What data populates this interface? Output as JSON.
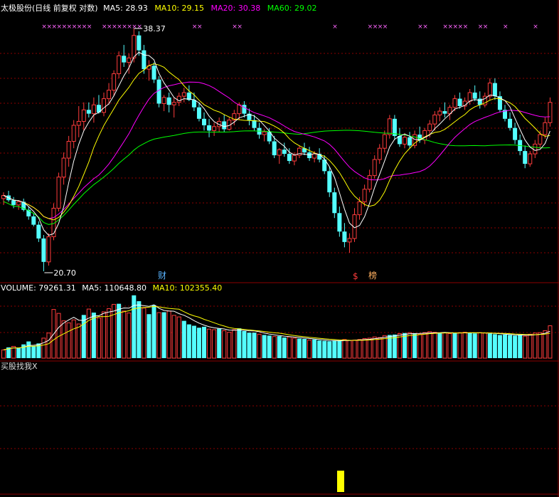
{
  "colors": {
    "background": "#000000",
    "up": "#ff3c3c",
    "down": "#54ffff",
    "grid": "#8c0000",
    "ma5": "#ffffff",
    "ma10": "#ffff00",
    "ma20": "#ff00ff",
    "ma60": "#00ff00",
    "signal": "#ffff00"
  },
  "header": {
    "title": "太极股份(日线 前复权 对数)",
    "ma5_label": "MA5:",
    "ma5_value": "28.93",
    "ma10_label": "MA10:",
    "ma10_value": "29.15",
    "ma20_label": "MA20:",
    "ma20_value": "30.38",
    "ma60_label": "MA60:",
    "ma60_value": "29.02"
  },
  "volume_header": {
    "label": "VOLUME:",
    "value": "79261.31",
    "ma5_label": "MA5:",
    "ma5_value": "110648.80",
    "ma10_label": "MA10:",
    "ma10_value": "102355.40"
  },
  "indicator_header": {
    "label": "买股找我X"
  },
  "chart_data": {
    "type": "candlestick",
    "scale": "log",
    "max_label": "38.37",
    "min_label": "20.70",
    "event_labels": {
      "cai": "财",
      "dollar": "$",
      "bang": "榜"
    },
    "candles": [
      [
        24.9,
        25.3,
        24.5,
        25.1
      ],
      [
        25.1,
        25.4,
        24.7,
        24.8
      ],
      [
        24.8,
        25.0,
        24.3,
        24.5
      ],
      [
        24.5,
        24.8,
        24.2,
        24.7
      ],
      [
        24.7,
        24.9,
        24.1,
        24.2
      ],
      [
        24.2,
        24.4,
        23.6,
        23.8
      ],
      [
        23.8,
        24.0,
        23.2,
        23.3
      ],
      [
        23.3,
        23.5,
        22.3,
        22.5
      ],
      [
        22.5,
        22.7,
        20.7,
        21.2
      ],
      [
        21.2,
        22.8,
        21.0,
        22.6
      ],
      [
        22.6,
        24.6,
        22.4,
        24.3
      ],
      [
        24.3,
        26.6,
        24.1,
        26.3
      ],
      [
        26.3,
        28.0,
        25.8,
        27.6
      ],
      [
        27.6,
        29.2,
        27.0,
        28.8
      ],
      [
        28.8,
        30.4,
        28.3,
        30.0
      ],
      [
        30.0,
        31.5,
        29.1,
        30.3
      ],
      [
        30.3,
        31.8,
        29.6,
        31.2
      ],
      [
        31.2,
        31.8,
        30.6,
        30.9
      ],
      [
        30.9,
        32.2,
        30.2,
        31.6
      ],
      [
        31.6,
        32.4,
        30.9,
        31.0
      ],
      [
        31.0,
        32.6,
        30.7,
        32.1
      ],
      [
        32.1,
        33.4,
        31.6,
        32.8
      ],
      [
        32.8,
        34.5,
        32.3,
        34.2
      ],
      [
        34.2,
        36.2,
        33.8,
        35.8
      ],
      [
        35.8,
        36.8,
        34.8,
        35.2
      ],
      [
        35.2,
        36.0,
        34.2,
        35.6
      ],
      [
        35.6,
        38.37,
        35.2,
        37.7
      ],
      [
        37.7,
        38.1,
        35.8,
        36.3
      ],
      [
        36.3,
        36.8,
        34.2,
        34.6
      ],
      [
        34.6,
        35.4,
        33.6,
        34.9
      ],
      [
        34.9,
        35.2,
        33.4,
        33.7
      ],
      [
        33.7,
        34.0,
        31.4,
        31.7
      ],
      [
        31.7,
        32.4,
        31.1,
        32.2
      ],
      [
        32.2,
        32.6,
        31.0,
        31.6
      ],
      [
        31.6,
        32.2,
        30.6,
        31.8
      ],
      [
        31.8,
        32.6,
        31.5,
        32.3
      ],
      [
        32.3,
        33.0,
        31.8,
        32.6
      ],
      [
        32.6,
        33.2,
        31.9,
        32.0
      ],
      [
        32.0,
        32.6,
        31.1,
        31.4
      ],
      [
        31.4,
        31.8,
        30.3,
        30.5
      ],
      [
        30.5,
        31.0,
        29.6,
        30.0
      ],
      [
        30.0,
        30.5,
        29.1,
        29.6
      ],
      [
        29.6,
        30.2,
        29.2,
        29.9
      ],
      [
        29.9,
        30.6,
        29.5,
        30.3
      ],
      [
        30.3,
        30.8,
        29.5,
        29.7
      ],
      [
        29.7,
        30.6,
        29.6,
        30.4
      ],
      [
        30.4,
        31.2,
        30.0,
        30.9
      ],
      [
        30.9,
        31.8,
        30.4,
        31.6
      ],
      [
        31.6,
        31.9,
        30.6,
        30.9
      ],
      [
        30.9,
        31.3,
        30.0,
        30.4
      ],
      [
        30.4,
        30.8,
        29.6,
        29.8
      ],
      [
        29.8,
        30.2,
        29.0,
        29.3
      ],
      [
        29.3,
        29.7,
        28.8,
        29.5
      ],
      [
        29.5,
        29.8,
        28.6,
        28.8
      ],
      [
        28.8,
        29.2,
        27.6,
        27.8
      ],
      [
        27.8,
        28.3,
        27.2,
        28.2
      ],
      [
        28.2,
        28.7,
        27.7,
        27.9
      ],
      [
        27.9,
        28.3,
        27.2,
        27.4
      ],
      [
        27.4,
        28.0,
        27.1,
        27.8
      ],
      [
        27.8,
        28.5,
        27.6,
        28.3
      ],
      [
        28.3,
        28.7,
        27.8,
        28.0
      ],
      [
        28.0,
        28.4,
        27.4,
        27.6
      ],
      [
        27.6,
        28.1,
        27.3,
        27.9
      ],
      [
        27.9,
        28.3,
        27.3,
        27.5
      ],
      [
        27.5,
        27.8,
        26.5,
        26.7
      ],
      [
        26.7,
        27.0,
        25.0,
        25.3
      ],
      [
        25.3,
        25.6,
        23.7,
        24.0
      ],
      [
        24.0,
        24.4,
        22.6,
        22.9
      ],
      [
        22.9,
        23.4,
        22.0,
        22.3
      ],
      [
        22.3,
        22.8,
        21.7,
        22.5
      ],
      [
        22.5,
        24.3,
        22.3,
        23.9
      ],
      [
        23.9,
        25.0,
        23.6,
        24.7
      ],
      [
        24.7,
        25.8,
        24.4,
        25.5
      ],
      [
        25.5,
        26.8,
        25.3,
        26.4
      ],
      [
        26.4,
        27.8,
        26.2,
        27.5
      ],
      [
        27.5,
        28.6,
        27.2,
        28.3
      ],
      [
        28.3,
        29.6,
        28.0,
        29.3
      ],
      [
        29.3,
        30.8,
        29.0,
        30.5
      ],
      [
        30.5,
        30.8,
        28.9,
        29.2
      ],
      [
        29.2,
        29.8,
        28.4,
        28.6
      ],
      [
        28.6,
        29.4,
        28.3,
        29.1
      ],
      [
        29.1,
        29.5,
        28.3,
        28.5
      ],
      [
        28.5,
        29.6,
        28.3,
        29.3
      ],
      [
        29.3,
        29.9,
        28.7,
        28.9
      ],
      [
        28.9,
        29.8,
        28.6,
        29.6
      ],
      [
        29.6,
        30.4,
        29.1,
        30.1
      ],
      [
        30.1,
        31.1,
        29.6,
        30.8
      ],
      [
        30.8,
        31.4,
        30.3,
        31.1
      ],
      [
        31.1,
        31.8,
        30.6,
        30.9
      ],
      [
        30.9,
        31.6,
        30.4,
        31.4
      ],
      [
        31.4,
        32.4,
        31.1,
        32.1
      ],
      [
        32.1,
        32.6,
        31.3,
        31.5
      ],
      [
        31.5,
        32.2,
        31.2,
        31.9
      ],
      [
        31.9,
        32.9,
        31.6,
        32.6
      ],
      [
        32.6,
        33.2,
        31.9,
        32.1
      ],
      [
        32.1,
        32.7,
        31.3,
        31.6
      ],
      [
        31.6,
        32.6,
        31.4,
        32.3
      ],
      [
        32.3,
        33.8,
        32.0,
        33.4
      ],
      [
        33.4,
        33.8,
        32.0,
        32.3
      ],
      [
        32.3,
        32.7,
        31.0,
        31.2
      ],
      [
        31.2,
        31.6,
        30.3,
        30.5
      ],
      [
        30.5,
        31.0,
        29.6,
        29.8
      ],
      [
        29.8,
        30.2,
        28.6,
        28.9
      ],
      [
        28.9,
        29.3,
        27.8,
        28.1
      ],
      [
        28.1,
        28.5,
        26.9,
        27.2
      ],
      [
        27.2,
        28.1,
        27.0,
        27.9
      ],
      [
        27.9,
        28.9,
        27.6,
        28.6
      ],
      [
        28.6,
        29.6,
        28.3,
        29.3
      ],
      [
        29.3,
        30.6,
        29.0,
        30.2
      ],
      [
        30.2,
        32.2,
        29.9,
        31.8
      ]
    ],
    "volume": {
      "values": [
        42,
        55,
        60,
        52,
        70,
        85,
        62,
        75,
        102,
        128,
        248,
        228,
        190,
        180,
        195,
        174,
        220,
        250,
        232,
        205,
        236,
        252,
        274,
        277,
        240,
        230,
        320,
        290,
        255,
        224,
        270,
        232,
        234,
        240,
        218,
        210,
        190,
        172,
        165,
        155,
        160,
        148,
        145,
        150,
        140,
        132,
        145,
        152,
        138,
        130,
        130,
        122,
        118,
        115,
        110,
        112,
        105,
        108,
        102,
        100,
        98,
        92,
        95,
        90,
        88,
        86,
        88,
        90,
        95,
        90,
        92,
        95,
        100,
        102,
        108,
        105,
        115,
        118,
        120,
        125,
        128,
        130,
        125,
        122,
        130,
        135,
        132,
        128,
        130,
        125,
        128,
        130,
        132,
        128,
        126,
        130,
        128,
        125,
        122,
        118,
        120,
        118,
        115,
        118,
        112,
        122,
        128,
        130,
        140,
        165
      ],
      "up_flags": [
        1,
        0,
        1,
        0,
        0,
        0,
        0,
        0,
        1,
        1,
        1,
        1,
        1,
        1,
        1,
        1,
        0,
        1,
        0,
        1,
        1,
        1,
        1,
        0,
        1,
        1,
        0,
        0,
        1,
        0,
        0,
        1,
        0,
        1,
        1,
        1,
        0,
        0,
        0,
        0,
        0,
        1,
        1,
        0,
        1,
        1,
        1,
        0,
        0,
        0,
        0,
        1,
        0,
        0,
        1,
        0,
        0,
        1,
        1,
        0,
        0,
        1,
        0,
        0,
        0,
        0,
        0,
        0,
        1,
        1,
        1,
        1,
        1,
        1,
        1,
        1,
        1,
        0,
        0,
        1,
        0,
        1,
        0,
        1,
        1,
        1,
        1,
        0,
        1,
        1,
        0,
        1,
        1,
        0,
        0,
        1,
        1,
        0,
        0,
        0,
        0,
        0,
        0,
        0,
        1,
        1,
        1,
        1,
        1,
        1
      ]
    }
  }
}
